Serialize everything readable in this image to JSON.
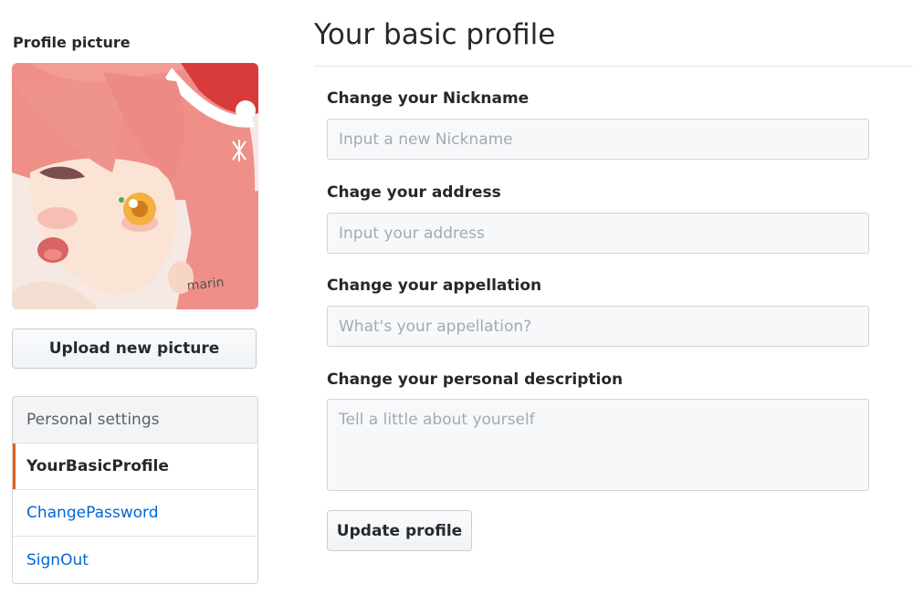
{
  "sidebar": {
    "picture_heading": "Profile picture",
    "avatar_signature": "marin",
    "upload_label": "Upload new picture",
    "menu": {
      "heading": "Personal settings",
      "items": [
        {
          "label": "YourBasicProfile",
          "selected": true
        },
        {
          "label": "ChangePassword",
          "selected": false
        },
        {
          "label": "SignOut",
          "selected": false
        }
      ]
    }
  },
  "main": {
    "title": "Your basic profile",
    "fields": [
      {
        "label": "Change your Nickname",
        "placeholder": "Input a new Nickname",
        "value": ""
      },
      {
        "label": "Chage your address",
        "placeholder": "Input your address",
        "value": ""
      },
      {
        "label": "Change your appellation",
        "placeholder": "What's your appellation?",
        "value": ""
      },
      {
        "label": "Change your personal description",
        "placeholder": "Tell a little about yourself",
        "value": ""
      }
    ],
    "submit_label": "Update profile"
  },
  "colors": {
    "accent_selected": "#e36209",
    "link": "#0366d6",
    "input_background": "#f6f8fa"
  }
}
